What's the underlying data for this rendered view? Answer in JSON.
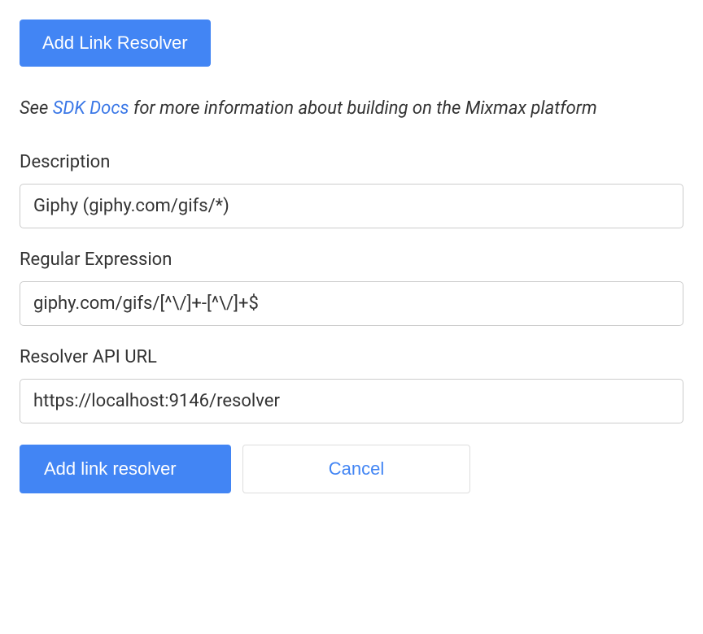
{
  "header": {
    "add_button_label": "Add Link Resolver"
  },
  "info": {
    "prefix": "See ",
    "link_text": "SDK Docs",
    "suffix": " for more information about building on the Mixmax platform"
  },
  "form": {
    "description": {
      "label": "Description",
      "value": "Giphy (giphy.com/gifs/*)"
    },
    "regex": {
      "label": "Regular Expression",
      "value": "giphy.com/gifs/[^\\/]+-[^\\/]+$"
    },
    "resolver_url": {
      "label": "Resolver API URL",
      "value": "https://localhost:9146/resolver"
    }
  },
  "actions": {
    "submit_label": "Add link resolver",
    "cancel_label": "Cancel"
  }
}
